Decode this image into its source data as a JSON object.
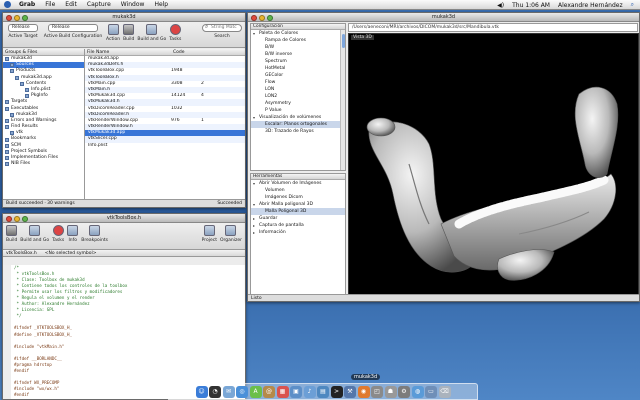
{
  "menubar": {
    "app": "Grab",
    "items": [
      "File",
      "Edit",
      "Capture",
      "Window",
      "Help"
    ],
    "clock": "Thu 1:06 AM",
    "user": "Alexandre Hernández"
  },
  "xcode": {
    "title": "mukak3d",
    "target_popup": "Release",
    "toolbar": [
      "Active Target",
      "Active Build Configuration",
      "Action",
      "Build",
      "Build and Go",
      "Tasks",
      "Search"
    ],
    "search_placeholder": "String Matc",
    "groups_header": "Groups & Files",
    "groups": [
      {
        "label": "mukak3d",
        "indent": 0
      },
      {
        "label": "Sources",
        "indent": 1
      },
      {
        "label": "Products",
        "indent": 1
      },
      {
        "label": "mukak3d.app",
        "indent": 2
      },
      {
        "label": "Contents",
        "indent": 3
      },
      {
        "label": "Info.plist",
        "indent": 4
      },
      {
        "label": "PkgInfo",
        "indent": 4
      },
      {
        "label": "Targets",
        "indent": 0
      },
      {
        "label": "Executables",
        "indent": 0
      },
      {
        "label": "mukak3d",
        "indent": 1
      },
      {
        "label": "Errors and Warnings",
        "indent": 0
      },
      {
        "label": "Find Results",
        "indent": 0
      },
      {
        "label": "vtk",
        "indent": 1
      },
      {
        "label": "Bookmarks",
        "indent": 0
      },
      {
        "label": "SCM",
        "indent": 0
      },
      {
        "label": "Project Symbols",
        "indent": 0
      },
      {
        "label": "Implementation Files",
        "indent": 0
      },
      {
        "label": "NIB Files",
        "indent": 0
      }
    ],
    "file_columns": [
      "File Name",
      "Code",
      ""
    ],
    "files": [
      {
        "name": "mukak3d.app",
        "code": "",
        "n": ""
      },
      {
        "name": "mukak3dDefs.h",
        "code": "",
        "n": ""
      },
      {
        "name": "vtkToolsBox.cpp",
        "code": "1948",
        "n": ""
      },
      {
        "name": "vtkToolsBox.h",
        "code": "",
        "n": ""
      },
      {
        "name": "vtkMain.cpp",
        "code": "3308",
        "n": "2"
      },
      {
        "name": "vtkMain.h",
        "code": "",
        "n": ""
      },
      {
        "name": "vtkMukak3d.cpp",
        "code": "14124",
        "n": "4"
      },
      {
        "name": "vtkMukak3d.h",
        "code": "",
        "n": ""
      },
      {
        "name": "vtkDicomReader.cpp",
        "code": "1032",
        "n": ""
      },
      {
        "name": "vtkDicomReader.h",
        "code": "",
        "n": ""
      },
      {
        "name": "vtkRenderWindow.cpp",
        "code": "976",
        "n": "1"
      },
      {
        "name": "vtkRenderWindow.h",
        "code": "",
        "n": ""
      },
      {
        "name": "vtkMukak3d.app",
        "code": "",
        "n": ""
      },
      {
        "name": "vtkSlicer.cpp",
        "code": "",
        "n": ""
      },
      {
        "name": "Info.plist",
        "code": "",
        "n": ""
      }
    ],
    "status_left": "Build succeeded · 30 warnings",
    "status_right": "Succeeded"
  },
  "editor": {
    "title": "vtkToolsBox.h",
    "toolbar": [
      "Build",
      "Build and Go",
      "Tasks",
      "Info",
      "Breakpoints",
      "Project",
      "Organizer"
    ],
    "nav_file": "vtkToolsBox.h",
    "nav_symbol": "<No selected symbol>",
    "code_lines": [
      "/*",
      " * vtkToolsBox.h",
      " * Clase: Toolbox de mukak3d",
      " * Contiene todos los controles de la toolbox",
      " * Permite usar los filtros y modificadores",
      " * Regula el volumen y el render",
      " * Author: Alexandre Hernández",
      " * Licencia: GPL",
      " */",
      "",
      "#ifndef _VTKTOOLSBOX_H_",
      "#define _VTKTOOLSBOX_H_",
      "",
      "#include \"vtkMain.h\"",
      "",
      "#ifdef __BORLANDC__",
      "#pragma hdrstop",
      "#endif",
      "",
      "#ifndef WX_PRECOMP",
      "#include \"wx/wx.h\"",
      "#endif",
      "",
      "#include <vtkImageData.h>",
      "#include <vtkSlicer.h>"
    ]
  },
  "mukak": {
    "title": "mukak3d",
    "path": "/Users/aeneconi/MRI/archivos/DICOM/mukak3d/src/Mandibula.vtk",
    "panel1_header": "Configuración",
    "panel1_items": [
      {
        "label": "Paleta de Colores",
        "tri": "▾",
        "indent": 0,
        "sel": false
      },
      {
        "label": "Rampa de Colores",
        "tri": "",
        "indent": 1,
        "sel": false
      },
      {
        "label": "B/W",
        "tri": "",
        "indent": 1,
        "sel": false
      },
      {
        "label": "B/W inverse",
        "tri": "",
        "indent": 1,
        "sel": false
      },
      {
        "label": "Spectrum",
        "tri": "",
        "indent": 1,
        "sel": false
      },
      {
        "label": "HotMetal",
        "tri": "",
        "indent": 1,
        "sel": false
      },
      {
        "label": "GEColor",
        "tri": "",
        "indent": 1,
        "sel": false
      },
      {
        "label": "Flow",
        "tri": "",
        "indent": 1,
        "sel": false
      },
      {
        "label": "LON",
        "tri": "",
        "indent": 1,
        "sel": false
      },
      {
        "label": "LON2",
        "tri": "",
        "indent": 1,
        "sel": false
      },
      {
        "label": "Asymmetry",
        "tri": "",
        "indent": 1,
        "sel": false
      },
      {
        "label": "P Value",
        "tri": "",
        "indent": 1,
        "sel": false
      },
      {
        "label": "Visualización de volúmenes",
        "tri": "▾",
        "indent": 0,
        "sel": false
      },
      {
        "label": "Escalar: Planos ortogonales",
        "tri": "",
        "indent": 1,
        "sel": true
      },
      {
        "label": "3D: Trazado de Rayos",
        "tri": "",
        "indent": 1,
        "sel": false
      }
    ],
    "panel2_header": "Herramientas",
    "panel2_items": [
      {
        "label": "Abrir Volumen de Imágenes",
        "tri": "▾",
        "indent": 0,
        "sel": false
      },
      {
        "label": "Volumen",
        "tri": "",
        "indent": 1,
        "sel": false
      },
      {
        "label": "Imágenes Dicom",
        "tri": "",
        "indent": 1,
        "sel": false
      },
      {
        "label": "Abrir Malla poligonal 3D",
        "tri": "▾",
        "indent": 0,
        "sel": false
      },
      {
        "label": "Malla Poligonal 3D",
        "tri": "",
        "indent": 1,
        "sel": true
      },
      {
        "label": "Guardar",
        "tri": "▸",
        "indent": 0,
        "sel": false
      },
      {
        "label": "Captura de pantalla",
        "tri": "▸",
        "indent": 0,
        "sel": false
      },
      {
        "label": "Información",
        "tri": "▸",
        "indent": 0,
        "sel": false
      }
    ],
    "viewport_label": "Vista 3D",
    "status": "Listo"
  },
  "dock": {
    "label": "mukak3d",
    "icons": [
      {
        "name": "finder-icon",
        "color": "#3b7dd8",
        "glyph": "☺"
      },
      {
        "name": "dashboard-icon",
        "color": "#333333",
        "glyph": "◔"
      },
      {
        "name": "mail-icon",
        "color": "#7aa7d6",
        "glyph": "✉"
      },
      {
        "name": "safari-icon",
        "color": "#4a90d9",
        "glyph": "◎"
      },
      {
        "name": "ichat-icon",
        "color": "#6bbf4a",
        "glyph": "A"
      },
      {
        "name": "address-book-icon",
        "color": "#b58a4a",
        "glyph": "@"
      },
      {
        "name": "ical-icon",
        "color": "#d9534f",
        "glyph": "▦"
      },
      {
        "name": "preview-icon",
        "color": "#5c8fc8",
        "glyph": "▣"
      },
      {
        "name": "itunes-icon",
        "color": "#6c9fd6",
        "glyph": "♪"
      },
      {
        "name": "iphoto-icon",
        "color": "#4e88c0",
        "glyph": "▤"
      },
      {
        "name": "terminal-icon",
        "color": "#222222",
        "glyph": ">"
      },
      {
        "name": "xcode-icon",
        "color": "#5577aa",
        "glyph": "⚒"
      },
      {
        "name": "firefox-icon",
        "color": "#e07a2e",
        "glyph": "◉"
      },
      {
        "name": "grab-icon",
        "color": "#8a8a8a",
        "glyph": "◰"
      },
      {
        "name": "mukak3d-icon",
        "color": "#999999",
        "glyph": "☗"
      },
      {
        "name": "system-preferences-icon",
        "color": "#7c7c7c",
        "glyph": "⚙"
      },
      {
        "name": "network-icon",
        "color": "#5a9bd8",
        "glyph": "◍"
      },
      {
        "name": "documents-icon",
        "color": "#6f8fb8",
        "glyph": "▭"
      },
      {
        "name": "trash-icon",
        "color": "#aab3bd",
        "glyph": "⌫"
      }
    ]
  }
}
